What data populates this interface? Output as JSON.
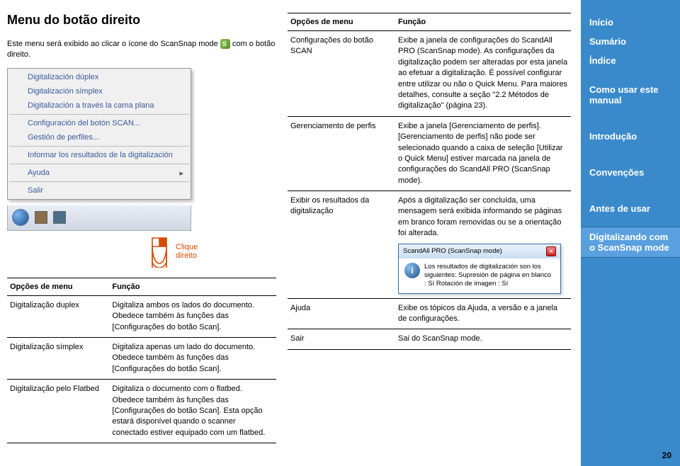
{
  "page": {
    "title": "Menu do botão direito",
    "number": "20"
  },
  "intro": {
    "part1": "Este menu será exibido ao clicar o ícone do ScanSnap mode ",
    "part2": " com o botão direito."
  },
  "contextMenu": {
    "items": [
      "Digitalización dúplex",
      "Digitalización símplex",
      "Digitalización a través la cama plana",
      "Configuración del botón SCAN...",
      "Gestión de perfiles...",
      "Informar los resultados de la digitalización",
      "Ayuda",
      "Salir"
    ]
  },
  "mouse": {
    "label1": "Clique",
    "label2": "direito"
  },
  "leftTable": {
    "headers": [
      "Opções de menu",
      "Função"
    ],
    "rows": [
      {
        "opt": "Digitalização duplex",
        "func": "Digitaliza ambos os lados do documento. Obedece também às funções das [Configurações do botão Scan]."
      },
      {
        "opt": "Digitalização símplex",
        "func": "Digitaliza apenas um lado do documento. Obedece também às funções das [Configurações do botão Scan]."
      },
      {
        "opt": "Digitalização pelo Flatbed",
        "func": "Digitaliza o documento com o flatbed. Obedece também às funções das [Configurações do botão Scan]. Esta opção estará disponível quando o scanner conectado estiver equipado com um flatbed."
      }
    ]
  },
  "rightTable": {
    "headers": [
      "Opções de menu",
      "Função"
    ],
    "rows": [
      {
        "opt": "Configurações do botão SCAN",
        "func": "Exibe a janela de configurações do ScandAll PRO (ScanSnap mode). As configurações da digitalização podem ser alteradas por esta janela ao efetuar a digitalização. É possível configurar entre utilizar ou não o Quick Menu. Para maiores detalhes, consulte a seção \"2.2 Métodos de digitalização\" (página 23)."
      },
      {
        "opt": "Gerenciamento de perfis",
        "func": "Exibe a janela [Gerenciamento de perfis]. [Gerenciamento de perfis] não pode ser selecionado quando a caixa de seleção [Utilizar o Quick Menu] estiver marcada na janela de configurações do ScandAll PRO (ScanSnap mode)."
      },
      {
        "opt": "Exibir os resultados da digitalização",
        "func": "Após a digitalização ser concluída, uma mensagem será exibida informando se páginas em branco foram removidas ou se a orientação foi alterada.",
        "dialog": true
      },
      {
        "opt": "Ajuda",
        "func": "Exibe os tópicos da Ajuda, a versão e a janela de configurações."
      },
      {
        "opt": "Sair",
        "func": "Sai do ScanSnap mode."
      }
    ]
  },
  "dialog": {
    "title": "ScandAll PRO (ScanSnap mode)",
    "body": "Los resultados de digitalización son los siguientes: Supresión de página en blanco : Sí Rotación de imagen : Sí"
  },
  "sidebar": {
    "items": [
      {
        "label": "Início"
      },
      {
        "label": "Sumário"
      },
      {
        "label": "Índice"
      },
      {
        "label": "Como usar este manual"
      },
      {
        "label": "Introdução"
      },
      {
        "label": "Convenções"
      },
      {
        "label": "Antes de usar"
      },
      {
        "label": "Digitalizando com o ScanSnap mode",
        "active": true
      }
    ]
  }
}
